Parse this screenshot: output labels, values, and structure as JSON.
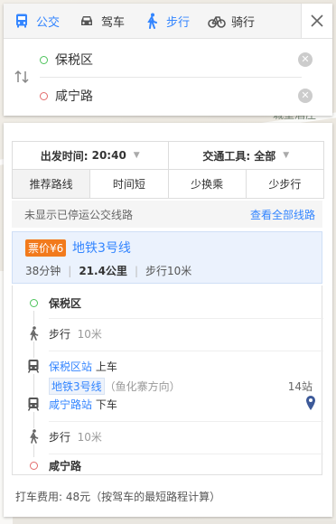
{
  "map": {
    "label": "城堡酒庄"
  },
  "modes": [
    {
      "label": "公交",
      "icon": "bus-icon",
      "active": true
    },
    {
      "label": "驾车",
      "icon": "car-icon",
      "active": false
    },
    {
      "label": "步行",
      "icon": "walk-icon",
      "active": false
    },
    {
      "label": "骑行",
      "icon": "bike-icon",
      "active": false
    }
  ],
  "origin": "保税区",
  "destination": "咸宁路",
  "options": {
    "depart_label": "出发时间:",
    "depart_value": "20:40",
    "vehicle_label": "交通工具:",
    "vehicle_value": "全部"
  },
  "tabs": [
    "推荐路线",
    "时间短",
    "少换乘",
    "少步行"
  ],
  "notice": {
    "text": "未显示已停运公交线路",
    "link": "查看全部线路"
  },
  "route": {
    "price": "票价¥6",
    "line": "地铁3号线",
    "duration": "38分钟",
    "distance": "21.4公里",
    "walk": "步行10米"
  },
  "steps": {
    "start": "保税区",
    "walk1_label": "步行",
    "walk1_dist": "10米",
    "board_station": "保税区站",
    "board_action": "上车",
    "line": "地铁3号线",
    "direction": "（鱼化寨方向）",
    "stop_count": "14站",
    "alight_station": "咸宁路站",
    "alight_action": "下车",
    "walk2_label": "步行",
    "walk2_dist": "10米",
    "end": "咸宁路"
  },
  "fare_note": "打车费用: 48元（按驾车的最短路程计算）",
  "colors": {
    "accent": "#3385ff",
    "price": "#f27a1c",
    "origin_dot": "#4cc35b",
    "dest_dot": "#e36c6c"
  }
}
